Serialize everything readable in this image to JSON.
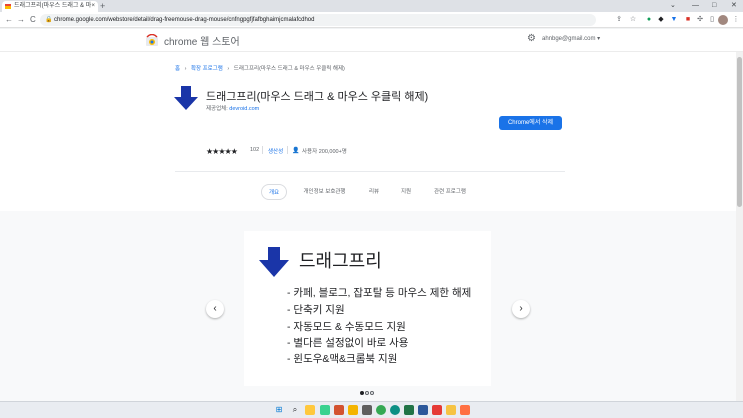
{
  "browser": {
    "tab_title": "드래그프리(마우스 드래그 & 마",
    "tab_close": "×",
    "new_tab": "+",
    "window_controls": [
      "⌄",
      "—",
      "□",
      "✕"
    ],
    "url": "chrome.google.com/webstore/detail/drag-freemouse-drag-mouse/cnfngpgfjfafbghaimjcmalafcdhod",
    "nav": {
      "back": "←",
      "forward": "→",
      "reload": "C"
    }
  },
  "store": {
    "name": "chrome 웹 스토어",
    "account": "ahnbge@gmail.com ▾",
    "settings_icon": "gear-icon"
  },
  "breadcrumb": {
    "home": "홈",
    "sep": "›",
    "category": "확장 프로그램",
    "current": "드래그프리(마우스 드래그 & 마우스 우클릭 해제)"
  },
  "extension": {
    "title": "드래그프리(마우스 드래그 & 마우스 우클릭 해제)",
    "provider_label": "제공업체: ",
    "provider": "devroid.com",
    "add_button": "Chrome에서 삭제",
    "stars": "★★★★★",
    "rating_count": "102",
    "category": "생산성",
    "users": "사용자 200,000+명",
    "icon_color": "#1a35a8"
  },
  "tabs": [
    {
      "label": "개요",
      "active": true
    },
    {
      "label": "개인정보 보호관행",
      "active": false
    },
    {
      "label": "리뷰",
      "active": false
    },
    {
      "label": "지원",
      "active": false
    },
    {
      "label": "관련 프로그램",
      "active": false
    }
  ],
  "gallery": {
    "slide_title": "드래그프리",
    "items": [
      "- 카페, 블로그, 잡포탈 등 마우스 제한 해제",
      "- 단축키 지원",
      "- 자동모드 & 수동모드 지원",
      "- 별다른 설정없이 바로 사용",
      "- 윈도우&맥&크롬북 지원"
    ],
    "prev": "‹",
    "next": "›",
    "slide_count": 3,
    "active_slide": 1
  },
  "taskbar": {
    "items": [
      "windows-icon",
      "search-icon",
      "file-explorer-icon",
      "whale-icon",
      "powerpoint-icon",
      "explorer-icon",
      "store-icon",
      "chrome-icon",
      "edge-icon",
      "excel-icon",
      "word-icon",
      "app-icon",
      "photo-icon",
      "app2-icon"
    ]
  }
}
